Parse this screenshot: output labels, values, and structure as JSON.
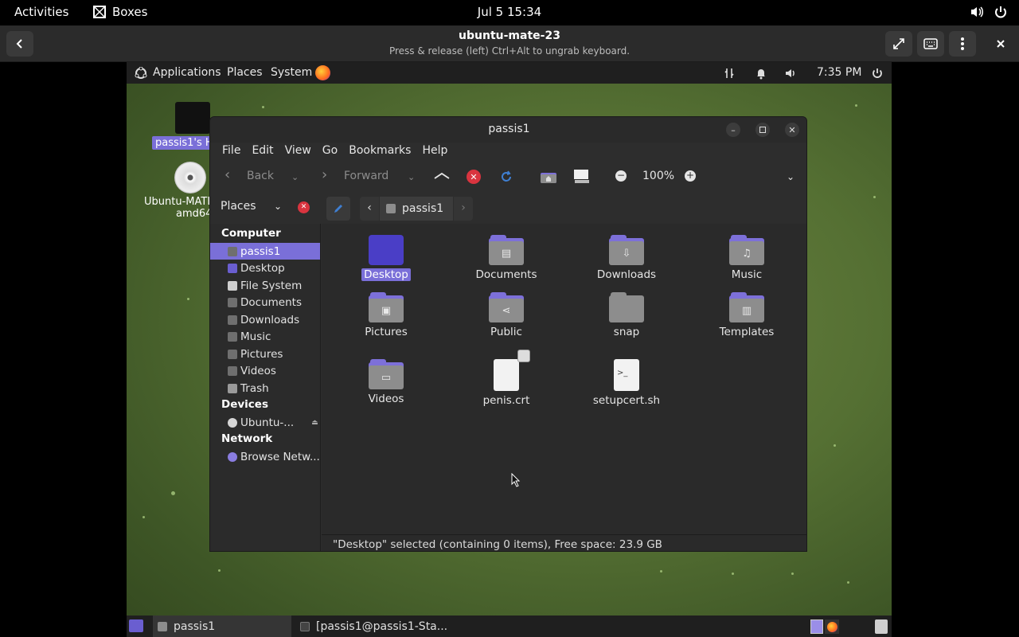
{
  "gnome": {
    "activities": "Activities",
    "app_name": "Boxes",
    "clock": "Jul 5  15:34"
  },
  "boxes": {
    "title": "ubuntu-mate-23",
    "subtitle": "Press & release (left) Ctrl+Alt to ungrab keyboard."
  },
  "mate_panel": {
    "applications": "Applications",
    "places": "Places",
    "system": "System",
    "time": "7:35 PM"
  },
  "desktop": {
    "home_label": "passis1's H",
    "disc_label_1": "Ubuntu-MATE",
    "disc_label_2": "amd64"
  },
  "window": {
    "title": "passis1",
    "menu": [
      "File",
      "Edit",
      "View",
      "Go",
      "Bookmarks",
      "Help"
    ],
    "toolbar": {
      "back": "Back",
      "forward": "Forward",
      "zoom": "100%"
    },
    "sidebar_mode": "Places",
    "breadcrumb": "passis1",
    "sidebar": {
      "computer_header": "Computer",
      "computer_items": [
        "passis1",
        "Desktop",
        "File System",
        "Documents",
        "Downloads",
        "Music",
        "Pictures",
        "Videos",
        "Trash"
      ],
      "devices_header": "Devices",
      "device_items": [
        "Ubuntu-..."
      ],
      "network_header": "Network",
      "network_items": [
        "Browse Netw..."
      ]
    },
    "files": [
      {
        "name": "Desktop",
        "icon": "folder-desktop-icon"
      },
      {
        "name": "Documents",
        "icon": "folder-documents-icon"
      },
      {
        "name": "Downloads",
        "icon": "folder-downloads-icon"
      },
      {
        "name": "Music",
        "icon": "folder-music-icon"
      },
      {
        "name": "Pictures",
        "icon": "folder-pictures-icon"
      },
      {
        "name": "Public",
        "icon": "folder-public-icon"
      },
      {
        "name": "snap",
        "icon": "folder-icon"
      },
      {
        "name": "Templates",
        "icon": "folder-templates-icon"
      },
      {
        "name": "Videos",
        "icon": "folder-videos-icon"
      },
      {
        "name": "penis.crt",
        "icon": "certificate-file-icon"
      },
      {
        "name": "setupcert.sh",
        "icon": "shell-script-icon"
      }
    ],
    "status": "\"Desktop\" selected (containing 0 items), Free space: 23.9 GB"
  },
  "taskbar": {
    "items": [
      "passis1",
      "[passis1@passis1-Sta..."
    ]
  },
  "colors": {
    "accent": "#7a6fd8",
    "folder_tab": "#7d70d9",
    "window_bg": "#2d2d2d",
    "stop_red": "#d9343f",
    "reload_blue": "#3f7fd1"
  }
}
